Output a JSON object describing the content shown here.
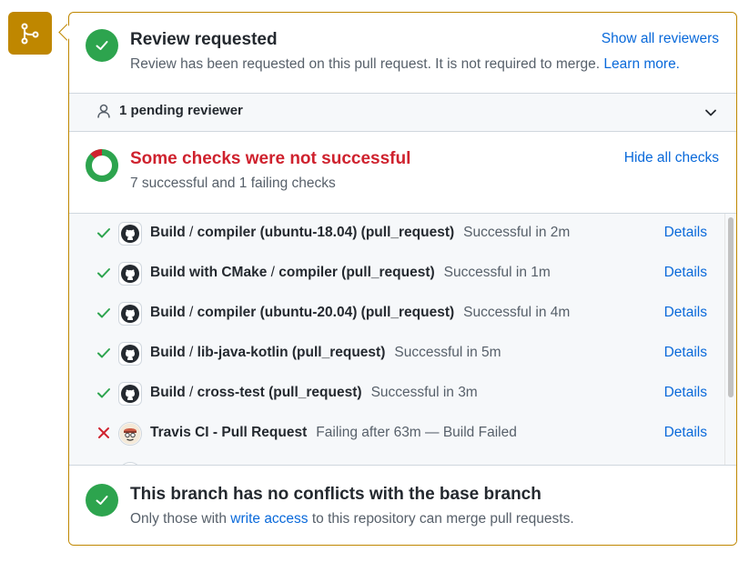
{
  "review": {
    "title": "Review requested",
    "description": "Review has been requested on this pull request. It is not required to merge.",
    "learn_more": "Learn more.",
    "show_all_reviewers": "Show all reviewers",
    "pending_reviewers": "1 pending reviewer"
  },
  "checks": {
    "title": "Some checks were not successful",
    "summary": "7 successful and 1 failing checks",
    "hide_all": "Hide all checks",
    "details_label": "Details",
    "items": [
      {
        "workflow": "Build",
        "separator": " / ",
        "job": "compiler (ubuntu-18.04) (pull_request)",
        "status": "Successful in 2m",
        "result": "success",
        "avatar_icon": "github-icon"
      },
      {
        "workflow": "Build with CMake",
        "separator": " / ",
        "job": "compiler (pull_request)",
        "status": "Successful in 1m",
        "result": "success",
        "avatar_icon": "github-icon"
      },
      {
        "workflow": "Build",
        "separator": " / ",
        "job": "compiler (ubuntu-20.04) (pull_request)",
        "status": "Successful in 4m",
        "result": "success",
        "avatar_icon": "github-icon"
      },
      {
        "workflow": "Build",
        "separator": " / ",
        "job": "lib-java-kotlin (pull_request)",
        "status": "Successful in 5m",
        "result": "success",
        "avatar_icon": "github-icon"
      },
      {
        "workflow": "Build",
        "separator": " / ",
        "job": "cross-test (pull_request)",
        "status": "Successful in 3m",
        "result": "success",
        "avatar_icon": "github-icon"
      },
      {
        "workflow": "Travis CI - Pull Request",
        "separator": "",
        "job": "",
        "status": "Failing after 63m — Build Failed",
        "result": "failure",
        "avatar_icon": "travis-ci-icon"
      }
    ]
  },
  "merge": {
    "title": "This branch has no conflicts with the base branch",
    "description_prefix": "Only those with",
    "write_access": "write access",
    "description_suffix": "to this repository can merge pull requests."
  },
  "colors": {
    "accent_attention": "#bf8700",
    "success": "#2da44e",
    "danger": "#cf222e",
    "link": "#0969da"
  }
}
